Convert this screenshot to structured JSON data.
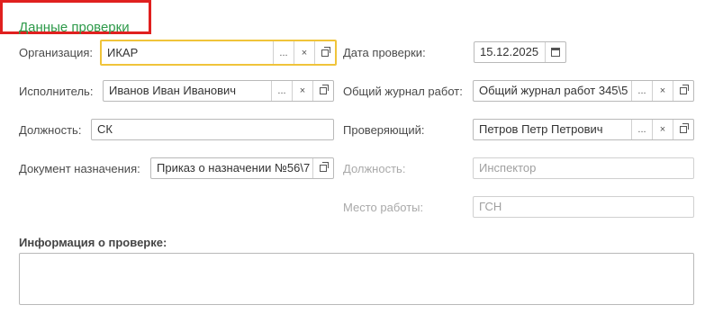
{
  "section": {
    "title": "Данные проверки"
  },
  "left": {
    "organization": {
      "label": "Организация:",
      "value": "ИКАР"
    },
    "executor": {
      "label": "Исполнитель:",
      "value": "Иванов Иван Иванович"
    },
    "position": {
      "label": "Должность:",
      "value": "СК"
    },
    "appointment_doc": {
      "label": "Документ назначения:",
      "value": "Приказ о назначении №56\\7"
    }
  },
  "right": {
    "check_date": {
      "label": "Дата проверки:",
      "value": "15.12.2025"
    },
    "journal": {
      "label": "Общий журнал работ:",
      "value": "Общий журнал работ 345\\5"
    },
    "inspector": {
      "label": "Проверяющий:",
      "value": "Петров Петр Петрович"
    },
    "inspector_position": {
      "label": "Должность:",
      "value": "Инспектор"
    },
    "workplace": {
      "label": "Место работы:",
      "value": "ГСН"
    }
  },
  "info": {
    "label": "Информация о проверке:",
    "value": ""
  },
  "buttons": {
    "ellipsis": "...",
    "clear": "×"
  },
  "colors": {
    "title": "#2e9a4a",
    "focus_border": "#f0c43a",
    "highlight": "#e0201f"
  }
}
